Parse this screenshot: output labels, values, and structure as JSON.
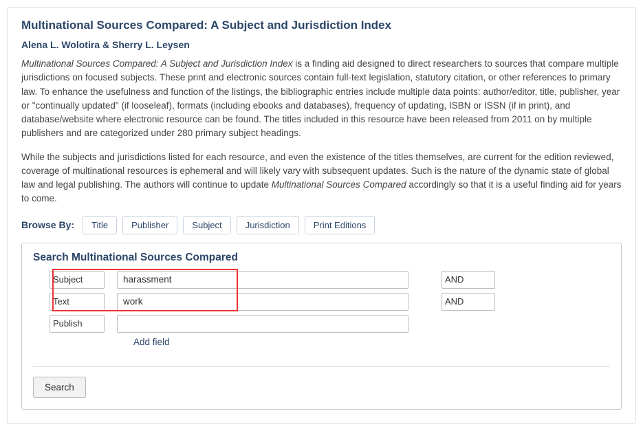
{
  "title": "Multinational Sources Compared: A Subject and Jurisdiction Index",
  "authors": "Alena L. Wolotira & Sherry L. Leysen",
  "para1_italic": "Multinational Sources Compared: A Subject and Jurisdiction Index",
  "para1_rest": " is a finding aid designed to direct researchers to sources that compare multiple jurisdictions on focused subjects. These print and electronic sources contain full-text legislation, statutory citation, or other references to primary law. To enhance the usefulness and function of the listings, the bibliographic entries include multiple data points: author/editor, title, publisher, year or \"continually updated\" (if looseleaf), formats (including ebooks and databases), frequency of updating, ISBN or ISSN (if in print), and database/website where electronic resource can be found. The titles included in this resource have been released from 2011 on by multiple publishers and are categorized under 280 primary subject headings.",
  "para2_a": "While the subjects and jurisdictions listed for each resource, and even the existence of the titles themselves, are current for the edition reviewed, coverage of multinational resources is ephemeral and will likely vary with subsequent updates. Such is the nature of the dynamic state of global law and legal publishing. The authors will continue to update ",
  "para2_italic": "Multinational Sources Compared",
  "para2_b": " accordingly so that it is a useful finding aid for years to come.",
  "browse": {
    "label": "Browse By:",
    "buttons": [
      "Title",
      "Publisher",
      "Subject",
      "Jurisdiction",
      "Print Editions"
    ]
  },
  "search": {
    "title": "Search Multinational Sources Compared",
    "rows": [
      {
        "field": "Subject",
        "value": "harassment",
        "bool": "AND"
      },
      {
        "field": "Text",
        "value": "work",
        "bool": "AND"
      },
      {
        "field": "Publish",
        "value": "",
        "bool": ""
      }
    ],
    "add_field": "Add field",
    "search_button": "Search"
  }
}
